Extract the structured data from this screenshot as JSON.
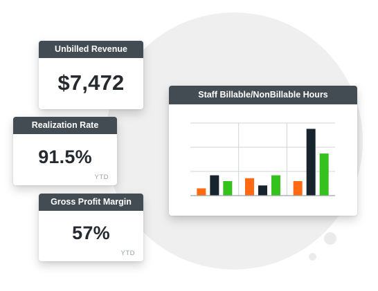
{
  "cards": {
    "unbilled": {
      "title": "Unbilled Revenue",
      "value": "$7,472"
    },
    "realization": {
      "title": "Realization Rate",
      "value": "91.5%",
      "note": "YTD"
    },
    "gross_profit": {
      "title": "Gross Profit Margin",
      "value": "57%",
      "note": "YTD"
    }
  },
  "chart_card": {
    "title": "Staff Billable/NonBillable Hours"
  },
  "colors": {
    "header": "#434c53",
    "orange": "#ff6a13",
    "navy": "#17232d",
    "green": "#35c21c"
  },
  "chart_data": {
    "type": "bar",
    "title": "Staff Billable/NonBillable Hours",
    "categories": [
      "",
      "",
      ""
    ],
    "series": [
      {
        "color": "#ff6a13",
        "values": [
          10,
          24,
          20
        ]
      },
      {
        "color": "#17232d",
        "values": [
          28,
          14,
          92
        ]
      },
      {
        "color": "#35c21c",
        "values": [
          20,
          28,
          58
        ]
      }
    ],
    "ylim": [
      0,
      100
    ],
    "grid": true,
    "xlabel": "",
    "ylabel": ""
  }
}
